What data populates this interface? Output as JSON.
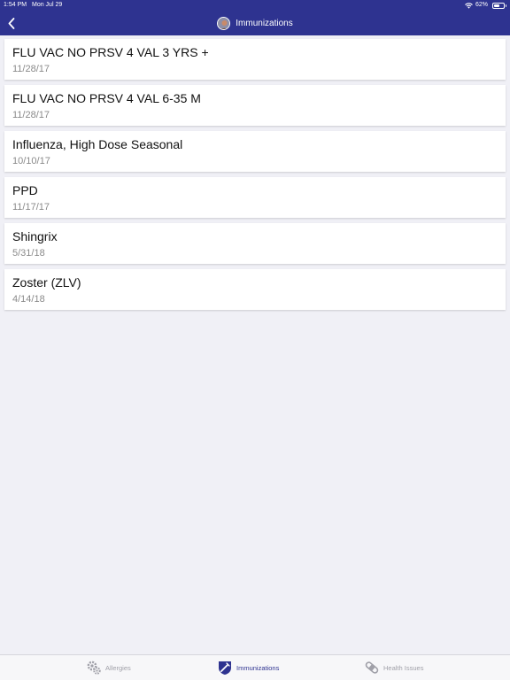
{
  "status_bar": {
    "time": "1:54 PM",
    "date": "Mon Jul 29",
    "battery": "62%",
    "battery_level": 0.62
  },
  "nav": {
    "title": "Immunizations",
    "back_icon": "chevron-left-icon"
  },
  "immunizations": [
    {
      "name": "FLU VAC NO PRSV 4 VAL 3 YRS +",
      "date": "11/28/17"
    },
    {
      "name": "FLU VAC NO PRSV 4 VAL 6-35 M",
      "date": "11/28/17"
    },
    {
      "name": "Influenza, High Dose Seasonal",
      "date": "10/10/17"
    },
    {
      "name": "PPD",
      "date": "11/17/17"
    },
    {
      "name": "Shingrix",
      "date": "5/31/18"
    },
    {
      "name": "Zoster (ZLV)",
      "date": "4/14/18"
    }
  ],
  "tabs": [
    {
      "label": "Allergies",
      "icon": "gears-icon",
      "active": false
    },
    {
      "label": "Immunizations",
      "icon": "syringe-shield-icon",
      "active": true
    },
    {
      "label": "Health Issues",
      "icon": "bandage-icon",
      "active": false
    }
  ],
  "colors": {
    "header": "#2e3390",
    "background": "#f0f0f6",
    "card": "#ffffff",
    "date_text": "#8a8a8a",
    "active_tab": "#2e3390",
    "inactive_tab": "#a0a0a8"
  }
}
